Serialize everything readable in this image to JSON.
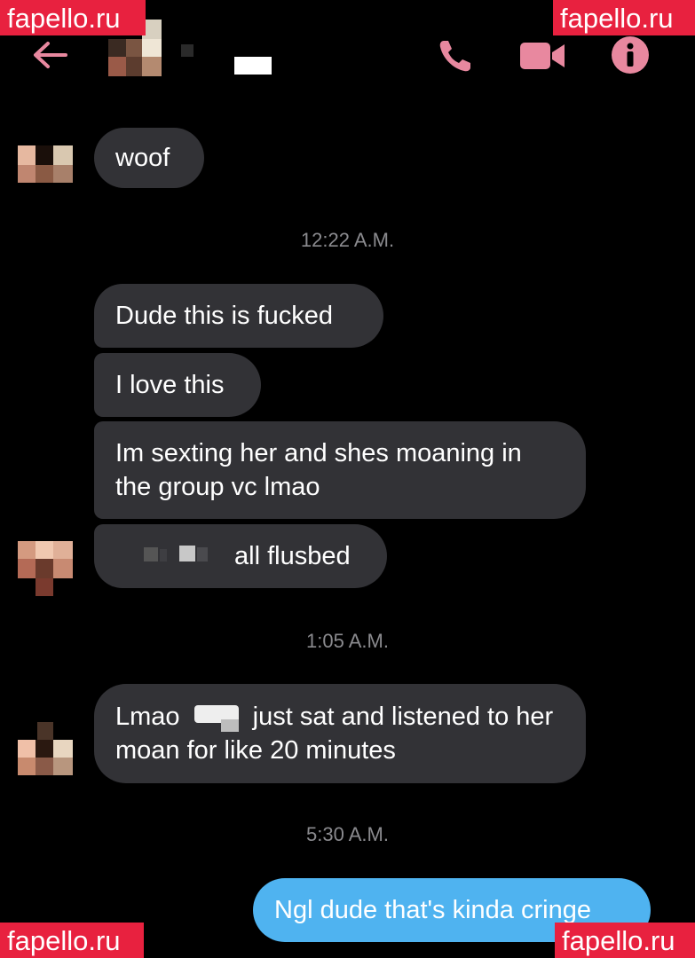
{
  "header": {
    "back_icon": "arrow-left-icon",
    "call_icon": "phone-icon",
    "video_icon": "video-camera-icon",
    "info_icon": "info-icon",
    "accent": "#e8889f"
  },
  "watermark": {
    "text": "fapello.ru",
    "color": "#e8213f"
  },
  "messages": {
    "woof": "woof",
    "ts1": "12:22 A.M.",
    "m1": "Dude this is fucked",
    "m2": "I love this",
    "m3": "Im sexting her and shes moaning in the group vc lmao",
    "m4": "all flusbed",
    "ts2": "1:05 A.M.",
    "m5_a": "Lmao",
    "m5_b": "just sat and listened to her moan for like 20 minutes",
    "ts3": "5:30 A.M.",
    "out1": "Ngl dude that's kinda cringe"
  },
  "colors": {
    "incoming_bubble": "#323236",
    "outgoing_bubble": "#4fb3f0",
    "timestamp": "#8a8a8e"
  }
}
